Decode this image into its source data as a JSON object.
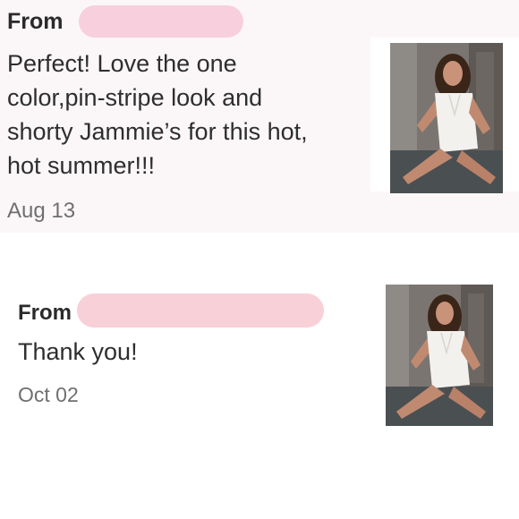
{
  "reviews": [
    {
      "from_label": "From",
      "message": "Perfect! Love the one color,pin-stripe look and shorty Jammie’s for this hot, hot summer!!!",
      "date": "Aug 13"
    },
    {
      "from_label": "From",
      "message": "Thank you!",
      "date": "Oct 02"
    }
  ],
  "colors": {
    "redaction": "#f8cfdc",
    "card_bg": "#fbf7f8",
    "date_text": "#6f6f6f"
  }
}
